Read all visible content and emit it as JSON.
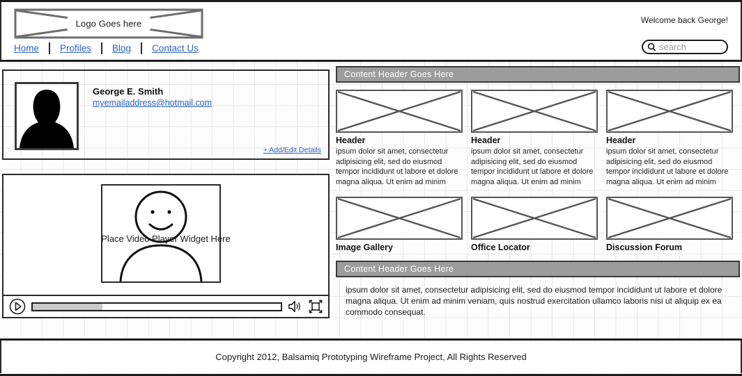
{
  "header": {
    "logo_text": "Logo Goes here",
    "welcome_text": "Welcome back George!",
    "search": {
      "placeholder": "search",
      "value": "",
      "icon": "search-icon"
    },
    "nav": [
      {
        "label": "Home"
      },
      {
        "label": "Profiles"
      },
      {
        "label": "Blog"
      },
      {
        "label": "Contact Us"
      }
    ]
  },
  "profile": {
    "avatar_icon": "user-silhouette-icon",
    "name": "George E. Smith",
    "email": "myemailaddress@hotmail.com",
    "add_edit_link": "+ Add/Edit Details"
  },
  "video": {
    "caption": "Place Video Player Widget Here",
    "image_icon": "person-smiley-icon",
    "play_icon": "play-icon",
    "volume_icon": "volume-icon",
    "fullscreen_icon": "fullscreen-icon",
    "progress_percent": 28
  },
  "content": {
    "header_top": "Content Header Goes Here",
    "header_bottom": "Content Header Goes Here",
    "cards_row1": [
      {
        "image_icon": "image-placeholder-icon",
        "title": "Header",
        "body": "ipsum dolor sit amet, consectetur adipisicing elit, sed do eiusmod tempor incididunt ut labore et dolore magna aliqua. Ut enim ad minim"
      },
      {
        "image_icon": "image-placeholder-icon",
        "title": "Header",
        "body": "ipsum dolor sit amet, consectetur adipisicing elit, sed do eiusmod tempor incididunt ut labore et dolore magna aliqua. Ut enim ad minim"
      },
      {
        "image_icon": "image-placeholder-icon",
        "title": "Header",
        "body": "ipsum dolor sit amet, consectetur adipisicing elit, sed do eiusmod tempor incididunt ut labore et dolore magna aliqua. Ut enim ad minim"
      }
    ],
    "cards_row2": [
      {
        "image_icon": "image-placeholder-icon",
        "title": "Image Gallery"
      },
      {
        "image_icon": "image-placeholder-icon",
        "title": "Office Locator"
      },
      {
        "image_icon": "image-placeholder-icon",
        "title": "Discussion Forum"
      }
    ],
    "bottom_body": "ipsum dolor sit amet, consectetur adipisicing elit, sed do eiusmod tempor incididunt ut labore et dolore magna aliqua. Ut enim ad minim veniam, quis nostrud exercitation ullamco laboris nisi ut aliquip ex ea commodo consequat."
  },
  "footer": {
    "copyright": "Copyright 2012, Balsamiq Prototyping Wireframe Project, All Rights Reserved"
  },
  "colors": {
    "link": "#2b61c4",
    "content_header_bg": "#9c9c9c",
    "frame": "#1c1c1c",
    "grid": "#e9e9e9"
  }
}
